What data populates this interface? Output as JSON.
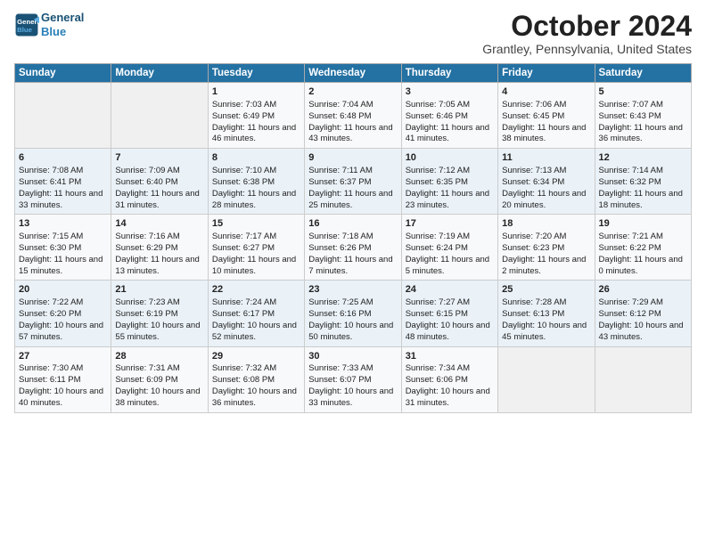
{
  "header": {
    "logo_line1": "General",
    "logo_line2": "Blue",
    "month": "October 2024",
    "location": "Grantley, Pennsylvania, United States"
  },
  "days_of_week": [
    "Sunday",
    "Monday",
    "Tuesday",
    "Wednesday",
    "Thursday",
    "Friday",
    "Saturday"
  ],
  "weeks": [
    [
      {
        "day": "",
        "info": ""
      },
      {
        "day": "",
        "info": ""
      },
      {
        "day": "1",
        "info": "Sunrise: 7:03 AM\nSunset: 6:49 PM\nDaylight: 11 hours and 46 minutes."
      },
      {
        "day": "2",
        "info": "Sunrise: 7:04 AM\nSunset: 6:48 PM\nDaylight: 11 hours and 43 minutes."
      },
      {
        "day": "3",
        "info": "Sunrise: 7:05 AM\nSunset: 6:46 PM\nDaylight: 11 hours and 41 minutes."
      },
      {
        "day": "4",
        "info": "Sunrise: 7:06 AM\nSunset: 6:45 PM\nDaylight: 11 hours and 38 minutes."
      },
      {
        "day": "5",
        "info": "Sunrise: 7:07 AM\nSunset: 6:43 PM\nDaylight: 11 hours and 36 minutes."
      }
    ],
    [
      {
        "day": "6",
        "info": "Sunrise: 7:08 AM\nSunset: 6:41 PM\nDaylight: 11 hours and 33 minutes."
      },
      {
        "day": "7",
        "info": "Sunrise: 7:09 AM\nSunset: 6:40 PM\nDaylight: 11 hours and 31 minutes."
      },
      {
        "day": "8",
        "info": "Sunrise: 7:10 AM\nSunset: 6:38 PM\nDaylight: 11 hours and 28 minutes."
      },
      {
        "day": "9",
        "info": "Sunrise: 7:11 AM\nSunset: 6:37 PM\nDaylight: 11 hours and 25 minutes."
      },
      {
        "day": "10",
        "info": "Sunrise: 7:12 AM\nSunset: 6:35 PM\nDaylight: 11 hours and 23 minutes."
      },
      {
        "day": "11",
        "info": "Sunrise: 7:13 AM\nSunset: 6:34 PM\nDaylight: 11 hours and 20 minutes."
      },
      {
        "day": "12",
        "info": "Sunrise: 7:14 AM\nSunset: 6:32 PM\nDaylight: 11 hours and 18 minutes."
      }
    ],
    [
      {
        "day": "13",
        "info": "Sunrise: 7:15 AM\nSunset: 6:30 PM\nDaylight: 11 hours and 15 minutes."
      },
      {
        "day": "14",
        "info": "Sunrise: 7:16 AM\nSunset: 6:29 PM\nDaylight: 11 hours and 13 minutes."
      },
      {
        "day": "15",
        "info": "Sunrise: 7:17 AM\nSunset: 6:27 PM\nDaylight: 11 hours and 10 minutes."
      },
      {
        "day": "16",
        "info": "Sunrise: 7:18 AM\nSunset: 6:26 PM\nDaylight: 11 hours and 7 minutes."
      },
      {
        "day": "17",
        "info": "Sunrise: 7:19 AM\nSunset: 6:24 PM\nDaylight: 11 hours and 5 minutes."
      },
      {
        "day": "18",
        "info": "Sunrise: 7:20 AM\nSunset: 6:23 PM\nDaylight: 11 hours and 2 minutes."
      },
      {
        "day": "19",
        "info": "Sunrise: 7:21 AM\nSunset: 6:22 PM\nDaylight: 11 hours and 0 minutes."
      }
    ],
    [
      {
        "day": "20",
        "info": "Sunrise: 7:22 AM\nSunset: 6:20 PM\nDaylight: 10 hours and 57 minutes."
      },
      {
        "day": "21",
        "info": "Sunrise: 7:23 AM\nSunset: 6:19 PM\nDaylight: 10 hours and 55 minutes."
      },
      {
        "day": "22",
        "info": "Sunrise: 7:24 AM\nSunset: 6:17 PM\nDaylight: 10 hours and 52 minutes."
      },
      {
        "day": "23",
        "info": "Sunrise: 7:25 AM\nSunset: 6:16 PM\nDaylight: 10 hours and 50 minutes."
      },
      {
        "day": "24",
        "info": "Sunrise: 7:27 AM\nSunset: 6:15 PM\nDaylight: 10 hours and 48 minutes."
      },
      {
        "day": "25",
        "info": "Sunrise: 7:28 AM\nSunset: 6:13 PM\nDaylight: 10 hours and 45 minutes."
      },
      {
        "day": "26",
        "info": "Sunrise: 7:29 AM\nSunset: 6:12 PM\nDaylight: 10 hours and 43 minutes."
      }
    ],
    [
      {
        "day": "27",
        "info": "Sunrise: 7:30 AM\nSunset: 6:11 PM\nDaylight: 10 hours and 40 minutes."
      },
      {
        "day": "28",
        "info": "Sunrise: 7:31 AM\nSunset: 6:09 PM\nDaylight: 10 hours and 38 minutes."
      },
      {
        "day": "29",
        "info": "Sunrise: 7:32 AM\nSunset: 6:08 PM\nDaylight: 10 hours and 36 minutes."
      },
      {
        "day": "30",
        "info": "Sunrise: 7:33 AM\nSunset: 6:07 PM\nDaylight: 10 hours and 33 minutes."
      },
      {
        "day": "31",
        "info": "Sunrise: 7:34 AM\nSunset: 6:06 PM\nDaylight: 10 hours and 31 minutes."
      },
      {
        "day": "",
        "info": ""
      },
      {
        "day": "",
        "info": ""
      }
    ]
  ]
}
